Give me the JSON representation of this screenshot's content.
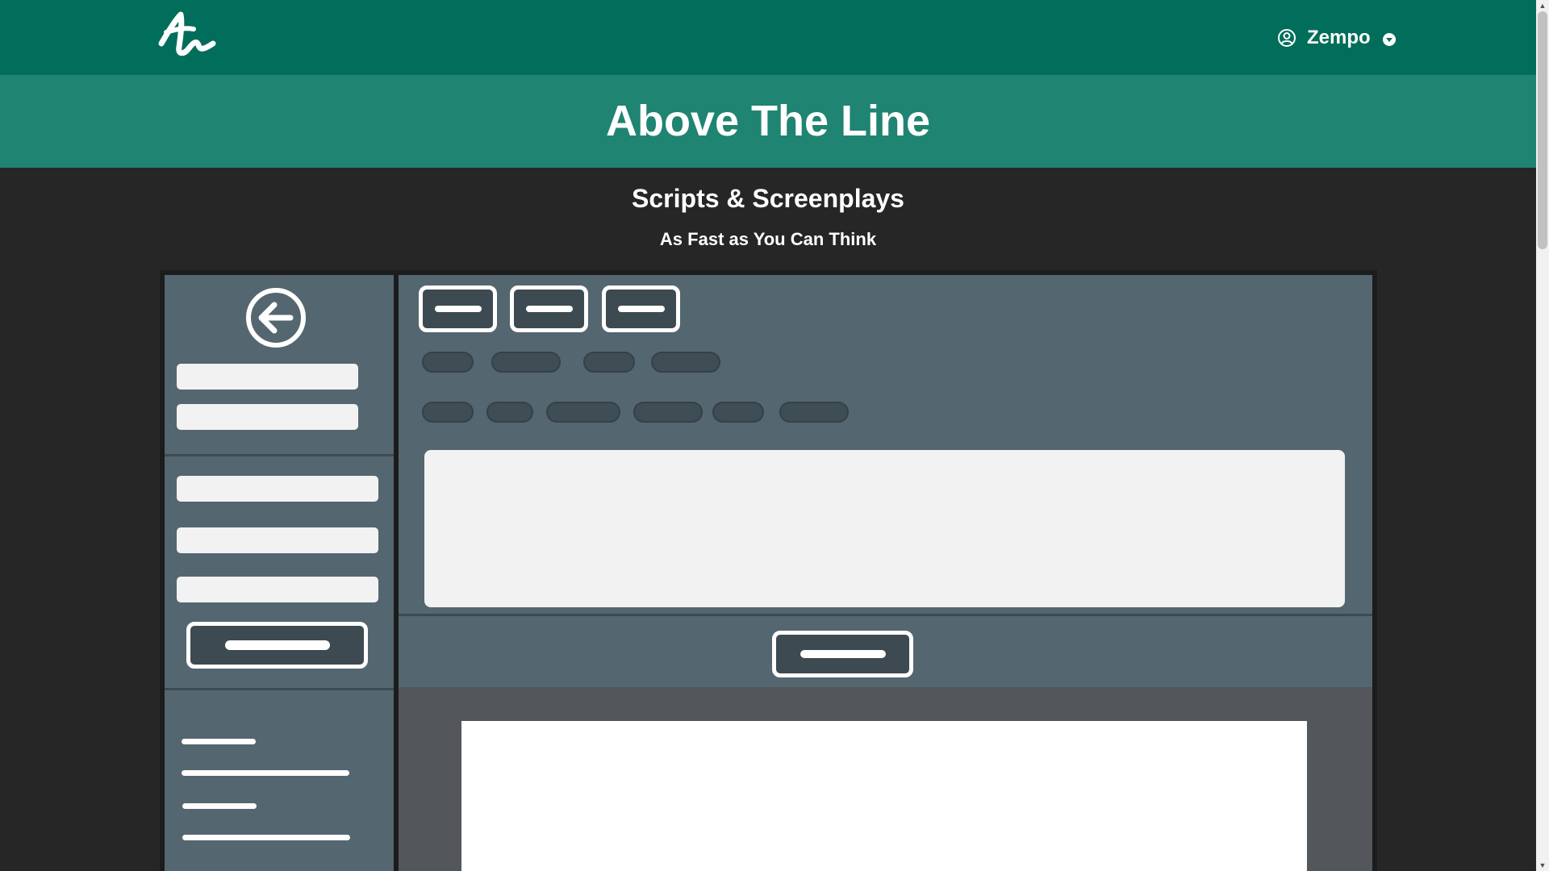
{
  "header": {
    "logo_alt": "Above The Line logo",
    "user_name": "Zempo"
  },
  "banner": {
    "title": "Above The Line"
  },
  "hero": {
    "headline": "Scripts & Screenplays",
    "tagline": "As Fast as You Can Think"
  },
  "colors": {
    "topbar": "#006e5a",
    "banner": "#1f8471",
    "background": "#262626",
    "mockup_panel": "#546670"
  },
  "icons": {
    "user": "user-circle-icon",
    "caret": "chevron-down-icon",
    "back": "arrow-left-circle-icon"
  }
}
